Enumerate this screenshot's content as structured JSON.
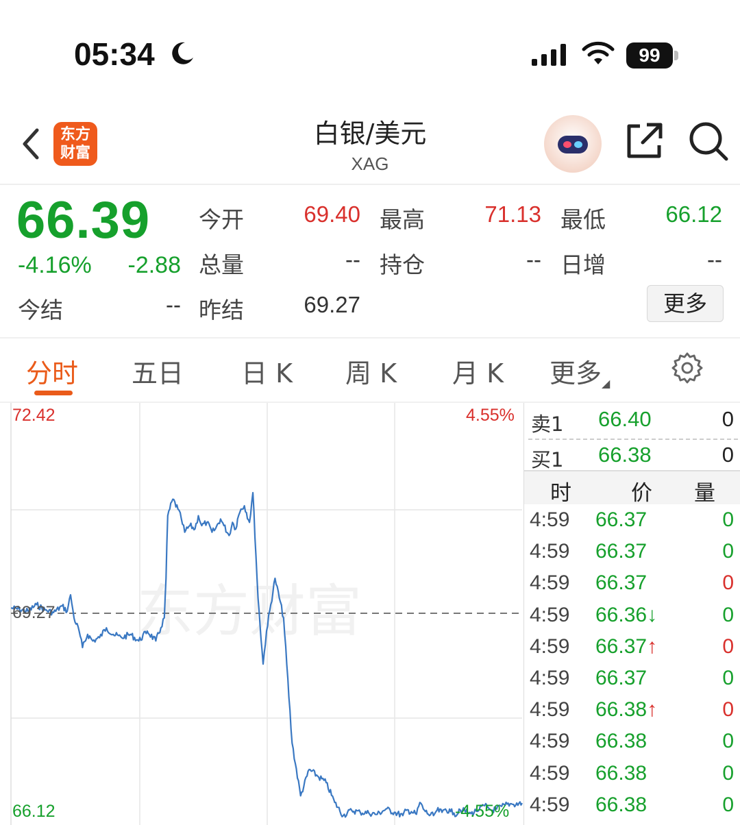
{
  "status_bar": {
    "time": "05:34",
    "battery": "99",
    "icons": [
      "moon-icon",
      "signal-icon",
      "wifi-icon",
      "battery-icon"
    ]
  },
  "nav": {
    "title": "白银/美元",
    "subtitle": "XAG",
    "logo_line1": "东方",
    "logo_line2": "财富",
    "icons": [
      "back-icon",
      "bot-avatar",
      "share-icon",
      "search-icon"
    ]
  },
  "quote": {
    "price": "66.39",
    "change_pct": "-4.16%",
    "change": "-2.88",
    "rows": [
      [
        {
          "label": "今开",
          "value": "69.40",
          "color": "#d9302c"
        },
        {
          "label": "最高",
          "value": "71.13",
          "color": "#d9302c"
        },
        {
          "label": "最低",
          "value": "66.12",
          "color": "#16a02c"
        }
      ],
      [
        {
          "label": "总量",
          "value": "--",
          "color": "#333333"
        },
        {
          "label": "持仓",
          "value": "--",
          "color": "#333333"
        },
        {
          "label": "日增",
          "value": "--",
          "color": "#333333"
        }
      ]
    ],
    "settle_label": "今结",
    "settle_value": "--",
    "prev_settle_label": "昨结",
    "prev_settle_value": "69.27",
    "more_label": "更多"
  },
  "tabs": {
    "items": [
      "分时",
      "五日",
      "日 K",
      "周 K",
      "月 K",
      "更多"
    ],
    "active": "分时"
  },
  "chart_data": {
    "type": "line",
    "title": "",
    "xlabel": "",
    "ylabel": "",
    "ylim": [
      66.12,
      72.42
    ],
    "y_max_label": "72.42",
    "y_min_label": "66.12",
    "y_mid_label": "69.27",
    "pct_max_label": "4.55%",
    "pct_min_label": "-4.55%",
    "reference_price": 69.27,
    "grid": true,
    "watermark": "东方财富",
    "series": [
      {
        "color": "#3a78c2",
        "x": [
          0,
          5,
          10,
          15,
          20,
          25,
          30,
          33,
          35,
          37,
          40,
          42,
          45,
          48,
          52,
          56,
          60,
          65,
          70,
          75,
          80,
          85,
          88,
          90,
          91,
          92,
          95,
          98,
          100,
          102,
          105,
          108,
          110,
          112,
          115,
          118,
          120,
          123,
          125,
          128,
          130,
          132,
          133,
          135,
          137,
          140,
          142,
          145,
          148,
          150,
          155,
          160,
          165,
          170,
          175,
          180,
          185,
          190,
          195,
          200,
          205,
          210,
          215,
          220,
          225,
          230,
          232,
          235,
          238,
          240,
          242,
          245,
          248,
          250,
          253,
          255,
          258,
          260,
          262,
          263,
          265,
          268,
          270,
          273,
          275,
          278,
          280,
          282,
          285,
          288,
          290,
          293,
          295,
          300
        ],
        "values": [
          69.35,
          69.33,
          69.3,
          69.4,
          69.32,
          69.28,
          69.38,
          69.3,
          69.55,
          69.2,
          69.0,
          68.75,
          68.95,
          68.85,
          68.9,
          69.05,
          68.95,
          68.9,
          68.95,
          68.85,
          69.0,
          68.85,
          69.05,
          69.2,
          69.8,
          70.75,
          71.0,
          70.85,
          70.7,
          70.5,
          70.6,
          70.55,
          70.75,
          70.6,
          70.65,
          70.5,
          70.55,
          70.7,
          70.6,
          70.45,
          70.65,
          70.55,
          70.7,
          70.85,
          70.9,
          70.65,
          71.1,
          69.5,
          68.5,
          69.0,
          69.8,
          69.2,
          67.3,
          66.5,
          66.9,
          66.8,
          66.7,
          66.4,
          66.2,
          66.28,
          66.25,
          66.24,
          66.22,
          66.3,
          66.25,
          66.2,
          66.28,
          66.26,
          66.22,
          66.4,
          66.3,
          66.22,
          66.2,
          66.28,
          66.25,
          66.3,
          66.26,
          66.24,
          66.22,
          66.3,
          66.28,
          66.25,
          66.23,
          66.27,
          66.3,
          66.35,
          66.32,
          66.28,
          66.3,
          66.34,
          66.36,
          66.38,
          66.37,
          66.39
        ]
      }
    ]
  },
  "order_book": {
    "ask_label": "卖1",
    "ask_price": "66.40",
    "ask_vol": "0",
    "bid_label": "买1",
    "bid_price": "66.38",
    "bid_vol": "0",
    "trade_headers": [
      "时",
      "价",
      "量"
    ],
    "trades": [
      {
        "time": "4:59",
        "price": "66.37",
        "arrow": "",
        "vol": "0",
        "vol_color": "#16a02c"
      },
      {
        "time": "4:59",
        "price": "66.37",
        "arrow": "",
        "vol": "0",
        "vol_color": "#16a02c"
      },
      {
        "time": "4:59",
        "price": "66.37",
        "arrow": "",
        "vol": "0",
        "vol_color": "#d9302c"
      },
      {
        "time": "4:59",
        "price": "66.36",
        "arrow": "↓",
        "vol": "0",
        "vol_color": "#16a02c"
      },
      {
        "time": "4:59",
        "price": "66.37",
        "arrow": "↑",
        "vol": "0",
        "vol_color": "#d9302c"
      },
      {
        "time": "4:59",
        "price": "66.37",
        "arrow": "",
        "vol": "0",
        "vol_color": "#16a02c"
      },
      {
        "time": "4:59",
        "price": "66.38",
        "arrow": "↑",
        "vol": "0",
        "vol_color": "#d9302c"
      },
      {
        "time": "4:59",
        "price": "66.38",
        "arrow": "",
        "vol": "0",
        "vol_color": "#16a02c"
      },
      {
        "time": "4:59",
        "price": "66.38",
        "arrow": "",
        "vol": "0",
        "vol_color": "#16a02c"
      },
      {
        "time": "4:59",
        "price": "66.38",
        "arrow": "",
        "vol": "0",
        "vol_color": "#16a02c"
      }
    ]
  },
  "colors": {
    "up": "#d9302c",
    "down": "#16a02c",
    "accent": "#ea5b1a",
    "line": "#3a78c2"
  }
}
